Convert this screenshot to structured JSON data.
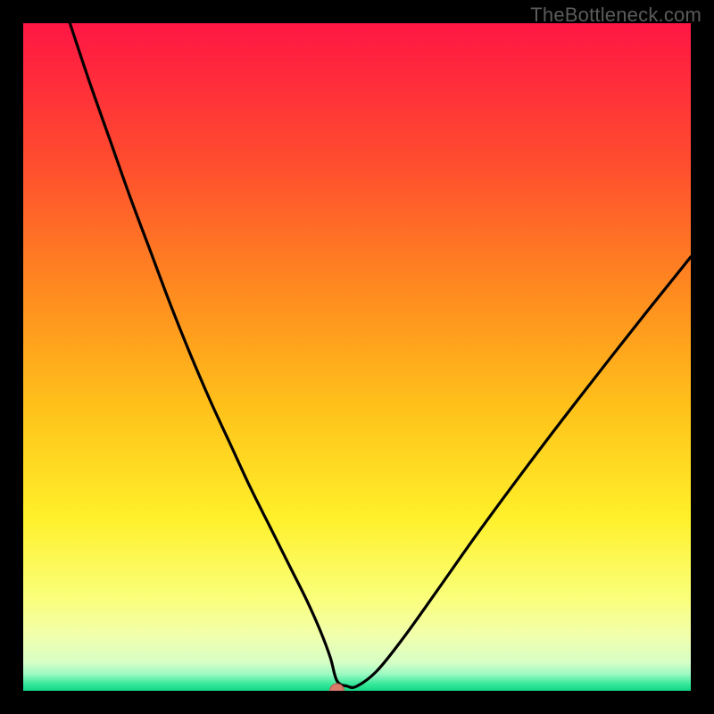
{
  "watermark": "TheBottleneck.com",
  "colors": {
    "frame": "#000000",
    "curve": "#000000",
    "marker_fill": "#d97a6b",
    "marker_stroke": "#b85a4d",
    "gradient_stops": [
      {
        "offset": 0.0,
        "color": "#ff1644"
      },
      {
        "offset": 0.2,
        "color": "#ff4a2f"
      },
      {
        "offset": 0.4,
        "color": "#ff8a1f"
      },
      {
        "offset": 0.58,
        "color": "#ffc31a"
      },
      {
        "offset": 0.74,
        "color": "#fff02a"
      },
      {
        "offset": 0.86,
        "color": "#faff7a"
      },
      {
        "offset": 0.92,
        "color": "#f0ffae"
      },
      {
        "offset": 0.958,
        "color": "#d6ffc6"
      },
      {
        "offset": 0.975,
        "color": "#9cf9c2"
      },
      {
        "offset": 0.99,
        "color": "#35e89a"
      },
      {
        "offset": 1.0,
        "color": "#14d685"
      }
    ]
  },
  "chart_data": {
    "type": "line",
    "title": "",
    "xlabel": "",
    "ylabel": "",
    "xlim": [
      0,
      100
    ],
    "ylim": [
      0,
      100
    ],
    "grid": false,
    "marker": {
      "x": 47,
      "y": 0
    },
    "series": [
      {
        "name": "bottleneck-curve",
        "x": [
          7,
          10,
          13,
          16,
          19,
          22,
          25,
          28,
          31,
          34,
          37,
          40,
          42.5,
          44.5,
          46,
          47,
          48.5,
          50,
          53,
          57,
          62,
          68,
          75,
          83,
          92,
          100
        ],
        "y": [
          100,
          91,
          82.5,
          74,
          66,
          58,
          50.5,
          43.5,
          37,
          30.5,
          24.5,
          18.5,
          13.5,
          9,
          5,
          1.5,
          0.7,
          0.7,
          3,
          8,
          15,
          23.5,
          33,
          43.5,
          55,
          65
        ]
      }
    ]
  }
}
